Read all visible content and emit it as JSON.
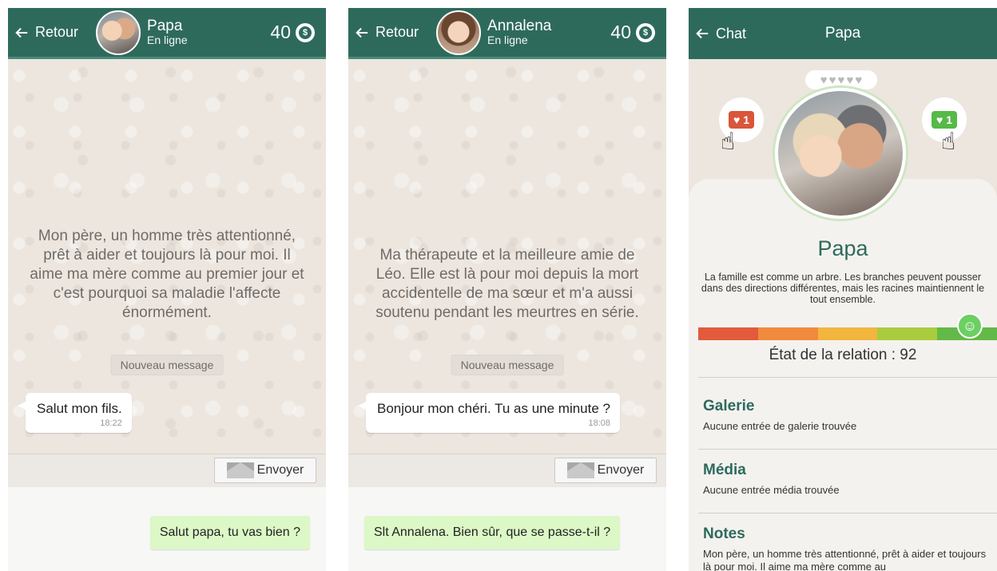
{
  "colors": {
    "header": "#2e6a5c",
    "bubble_out": "#dcf8c6",
    "accent": "#2e6a5c"
  },
  "chat1": {
    "back_label": "Retour",
    "contact_name": "Papa",
    "status": "En ligne",
    "coins": "40",
    "intro": "Mon père, un homme très attentionné, prêt à aider et toujours là pour moi. Il aime ma mère comme au  premier jour et c'est pourquoi sa maladie l'affecte énormément.",
    "new_message_label": "Nouveau message",
    "incoming": {
      "text": "Salut mon fils.",
      "time": "18:22"
    },
    "send_label": "Envoyer",
    "reply_option": "Salut papa, tu vas bien ?"
  },
  "chat2": {
    "back_label": "Retour",
    "contact_name": "Annalena",
    "status": "En ligne",
    "coins": "40",
    "intro": "Ma thérapeute et la meilleure amie de Léo. Elle est là pour moi depuis la mort accidentelle de ma sœur et m'a aussi soutenu pendant les meurtres en série.",
    "new_message_label": "Nouveau message",
    "incoming": {
      "text": "Bonjour mon chéri. Tu as une minute ?",
      "time": "18:08"
    },
    "send_label": "Envoyer",
    "reply_option": "Slt Annalena. Bien sûr, que se passe-t-il ?"
  },
  "profile": {
    "back_label": "Chat",
    "title": "Papa",
    "dislike_count": "1",
    "like_count": "1",
    "name": "Papa",
    "quote": "La famille est comme un arbre. Les branches peuvent pousser dans des directions différentes, mais les racines maintiennent le tout ensemble.",
    "relation_label": "État de la relation : 92",
    "relation_value": 92,
    "relation_colors": [
      "#e35b3a",
      "#f08a3e",
      "#f2b53d",
      "#a9cc3f",
      "#63b947"
    ],
    "gallery": {
      "title": "Galerie",
      "text": "Aucune entrée de galerie trouvée"
    },
    "media": {
      "title": "Média",
      "text": "Aucune entrée média trouvée"
    },
    "notes": {
      "title": "Notes",
      "text": "Mon père, un homme très attentionné, prêt à aider et toujours là pour moi. Il aime ma mère comme au"
    }
  }
}
